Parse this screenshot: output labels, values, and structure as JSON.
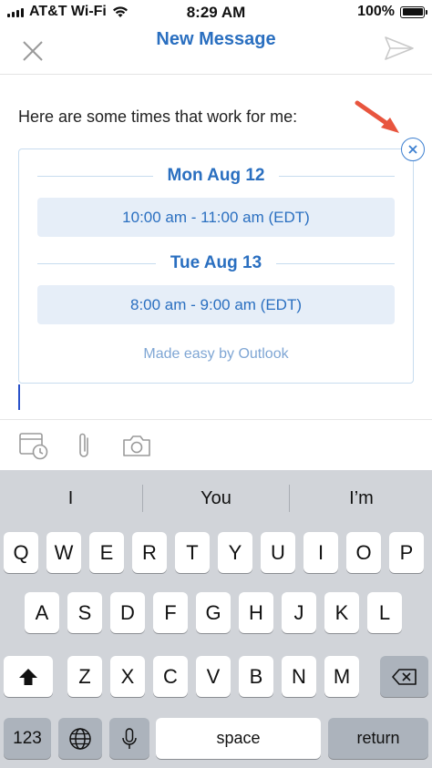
{
  "status_bar": {
    "carrier": "AT&T Wi-Fi",
    "time": "8:29 AM",
    "battery": "100%"
  },
  "nav": {
    "title": "New Message",
    "close_icon": "close-icon",
    "send_icon": "send-icon"
  },
  "compose": {
    "intro": "Here are some times that work for me:",
    "days": [
      {
        "date": "Mon Aug 12",
        "slot": "10:00 am - 11:00 am (EDT)"
      },
      {
        "date": "Tue Aug 13",
        "slot": "8:00 am - 9:00 am (EDT)"
      }
    ],
    "footer": "Made easy by Outlook"
  },
  "toolbar": {
    "icons": [
      "calendar-clock-icon",
      "paperclip-icon",
      "camera-icon"
    ]
  },
  "keyboard": {
    "suggestions": [
      "I",
      "You",
      "I’m"
    ],
    "row1": [
      "Q",
      "W",
      "E",
      "R",
      "T",
      "Y",
      "U",
      "I",
      "O",
      "P"
    ],
    "row2": [
      "A",
      "S",
      "D",
      "F",
      "G",
      "H",
      "J",
      "K",
      "L"
    ],
    "row3": [
      "Z",
      "X",
      "C",
      "V",
      "B",
      "N",
      "M"
    ],
    "numbers_key": "123",
    "space_key": "space",
    "return_key": "return"
  },
  "colors": {
    "accent": "#2a6fc0",
    "slot_bg": "#e6eef8",
    "keyboard_bg": "#d1d4d9",
    "annotation": "#e8553e"
  }
}
